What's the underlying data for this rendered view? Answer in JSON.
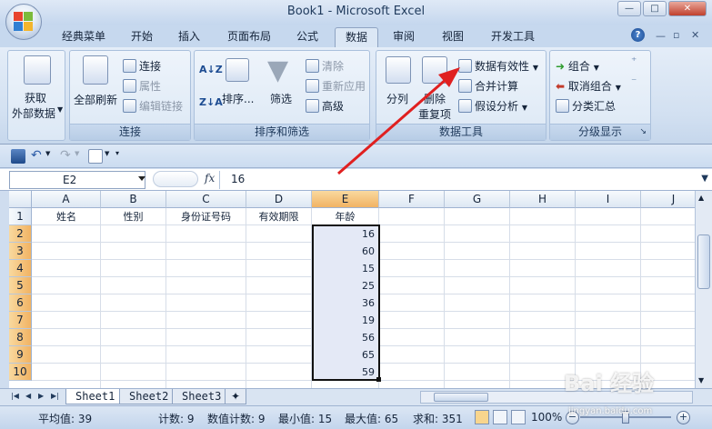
{
  "window": {
    "title": "Book1 - Microsoft Excel",
    "minimize": "—",
    "restore": "□",
    "close": "✕"
  },
  "tabs": [
    {
      "label": "经典菜单"
    },
    {
      "label": "开始"
    },
    {
      "label": "插入"
    },
    {
      "label": "页面布局"
    },
    {
      "label": "公式"
    },
    {
      "label": "数据"
    },
    {
      "label": "审阅"
    },
    {
      "label": "视图"
    },
    {
      "label": "开发工具"
    }
  ],
  "active_tab": "数据",
  "help_icon": "?",
  "ribbon": {
    "get_external": {
      "line1": "获取",
      "line2": "外部数据"
    },
    "connections_group": {
      "refresh_all": "全部刷新",
      "connections": "连接",
      "properties": "属性",
      "edit_links": "编辑链接",
      "label": "连接"
    },
    "sort_filter_group": {
      "sort": "排序...",
      "filter": "筛选",
      "clear": "清除",
      "reapply": "重新应用",
      "advanced": "高级",
      "label": "排序和筛选"
    },
    "data_tools_group": {
      "text_to_columns": "分列",
      "remove_dup_1": "删除",
      "remove_dup_2": "重复项",
      "data_validation": "数据有效性",
      "consolidate": "合并计算",
      "what_if": "假设分析",
      "label": "数据工具"
    },
    "outline_group": {
      "group": "组合",
      "ungroup": "取消组合",
      "subtotal": "分类汇总",
      "label": "分级显示"
    }
  },
  "formula_bar": {
    "name_box": "E2",
    "fx": "fx",
    "value": "16"
  },
  "columns": [
    "A",
    "B",
    "C",
    "D",
    "E",
    "F",
    "G",
    "H",
    "I",
    "J"
  ],
  "rows": [
    "1",
    "2",
    "3",
    "4",
    "5",
    "6",
    "7",
    "8",
    "9",
    "10"
  ],
  "headers_row": {
    "A": "姓名",
    "B": "性别",
    "C": "身份证号码",
    "D": "有效期限",
    "E": "年龄"
  },
  "age_values": [
    "16",
    "60",
    "15",
    "25",
    "36",
    "19",
    "56",
    "65",
    "59"
  ],
  "sheets": [
    "Sheet1",
    "Sheet2",
    "Sheet3"
  ],
  "status": {
    "average": "平均值: 39",
    "count": "计数: 9",
    "numeric_count": "数值计数: 9",
    "min": "最小值: 15",
    "max": "最大值: 65",
    "sum": "求和: 351",
    "zoom": "100%",
    "zoom_out": "−",
    "zoom_in": "+"
  },
  "watermark": {
    "text": "Bai 经验",
    "url": "jingyan.baidu.com"
  },
  "colors": {
    "accent_arrow": "#e02020",
    "selected_header": "#f1b363",
    "selection_fill": "#e4e9f6"
  }
}
